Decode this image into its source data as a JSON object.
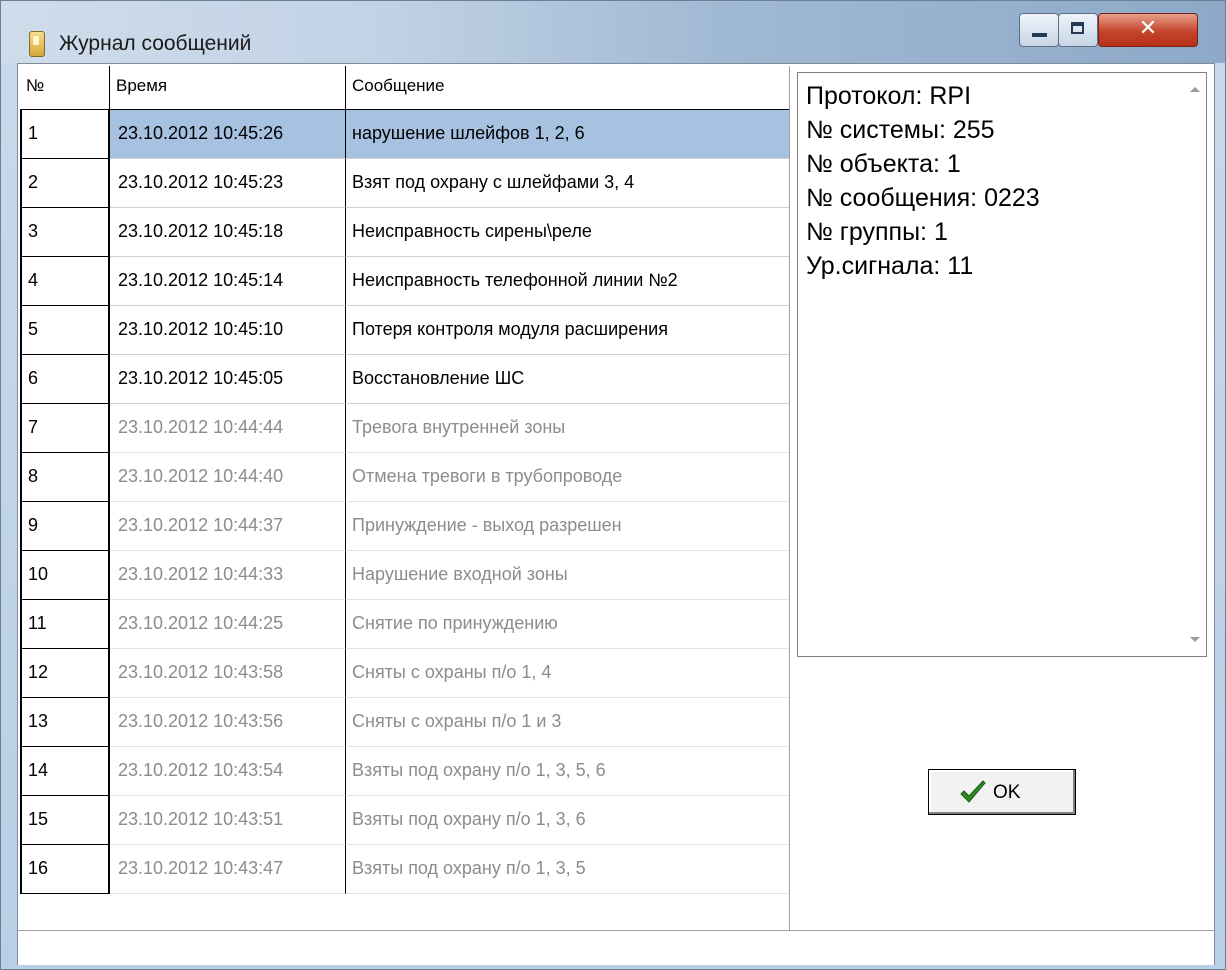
{
  "window": {
    "title": "Журнал сообщений"
  },
  "table": {
    "headers": {
      "num": "№",
      "time": "Время",
      "message": "Сообщение"
    },
    "rows": [
      {
        "num": "1",
        "time": "23.10.2012 10:45:26",
        "message": "нарушение шлейфов 1, 2, 6",
        "state": "selected"
      },
      {
        "num": "2",
        "time": "23.10.2012 10:45:23",
        "message": "Взят под охрану с шлейфами 3, 4",
        "state": "unread"
      },
      {
        "num": "3",
        "time": "23.10.2012 10:45:18",
        "message": "Неисправность сирены\\реле",
        "state": "unread"
      },
      {
        "num": "4",
        "time": "23.10.2012 10:45:14",
        "message": "Неисправность телефонной линии №2",
        "state": "unread"
      },
      {
        "num": "5",
        "time": "23.10.2012 10:45:10",
        "message": "Потеря контроля модуля расширения",
        "state": "unread"
      },
      {
        "num": "6",
        "time": "23.10.2012 10:45:05",
        "message": "Восстановление ШС",
        "state": "unread"
      },
      {
        "num": "7",
        "time": "23.10.2012 10:44:44",
        "message": "Тревога внутренней зоны",
        "state": "read"
      },
      {
        "num": "8",
        "time": "23.10.2012 10:44:40",
        "message": "Отмена тревоги в трубопроводе",
        "state": "read"
      },
      {
        "num": "9",
        "time": "23.10.2012 10:44:37",
        "message": "Принуждение  - выход разрешен",
        "state": "read"
      },
      {
        "num": "10",
        "time": "23.10.2012 10:44:33",
        "message": "Нарушение входной зоны",
        "state": "read"
      },
      {
        "num": "11",
        "time": "23.10.2012 10:44:25",
        "message": "Снятие по принуждению",
        "state": "read"
      },
      {
        "num": "12",
        "time": "23.10.2012 10:43:58",
        "message": "Сняты с охраны п/о  1, 4",
        "state": "read"
      },
      {
        "num": "13",
        "time": "23.10.2012 10:43:56",
        "message": "Сняты с охраны  п/о  1 и 3",
        "state": "read"
      },
      {
        "num": "14",
        "time": "23.10.2012 10:43:54",
        "message": "Взяты под охрану  п/о  1, 3, 5, 6",
        "state": "read"
      },
      {
        "num": "15",
        "time": "23.10.2012 10:43:51",
        "message": "Взяты под охрану   п/о  1, 3, 6",
        "state": "read"
      },
      {
        "num": "16",
        "time": "23.10.2012 10:43:47",
        "message": "Взяты под охрану   п/о  1, 3, 5",
        "state": "read"
      }
    ]
  },
  "details": {
    "lines": [
      "Протокол: RPI",
      "№ системы: 255",
      "№ объекта: 1",
      "№ сообщения: 0223",
      "№ группы: 1",
      "Ур.сигнала: 11"
    ]
  },
  "ok_button": {
    "label": "OK",
    "icon": "check-icon"
  },
  "colors": {
    "selected_row": "#a6c2e0",
    "read_text": "#8c8c8c",
    "close_button": "#c4442b"
  }
}
